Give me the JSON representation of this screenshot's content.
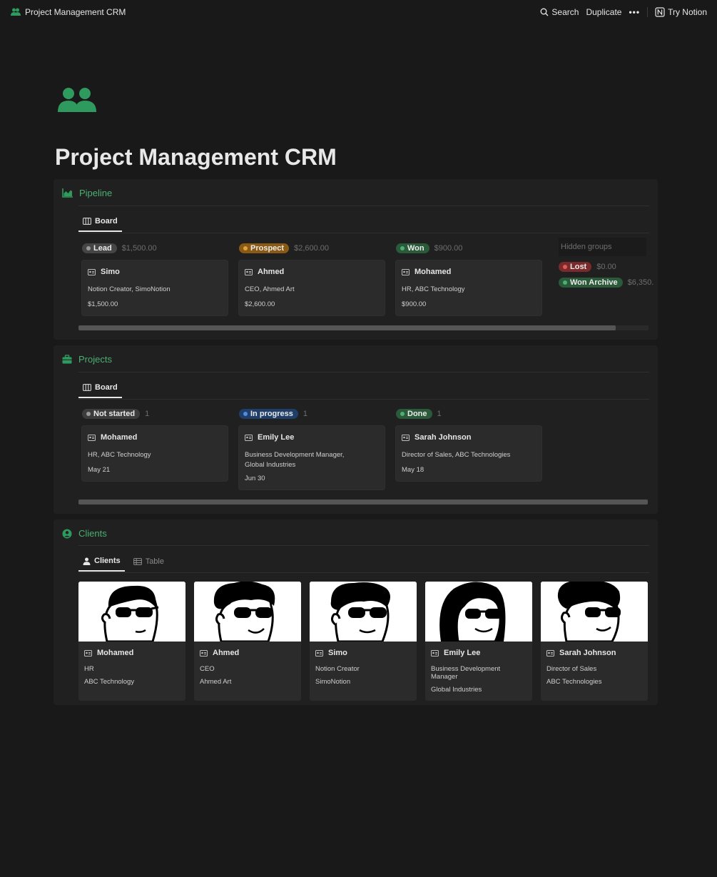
{
  "topbar": {
    "title": "Project Management CRM",
    "search": "Search",
    "duplicate": "Duplicate",
    "more": "•••",
    "try_notion": "Try Notion"
  },
  "page": {
    "title": "Project Management CRM",
    "icon": "people-icon",
    "accent": "#2e9a5e"
  },
  "pipeline": {
    "title": "Pipeline",
    "tab": "Board",
    "columns": [
      {
        "status": "Lead",
        "color": "#5a5a5a",
        "amount": "$1,500.00",
        "card": {
          "name": "Simo",
          "detail": "Notion Creator, SimoNotion",
          "value": "$1,500.00"
        }
      },
      {
        "status": "Prospect",
        "color": "#8a5a14",
        "amount": "$2,600.00",
        "card": {
          "name": "Ahmed",
          "detail": "CEO, Ahmed Art",
          "value": "$2,600.00"
        }
      },
      {
        "status": "Won",
        "color": "#2a5a3a",
        "amount": "$900.00",
        "card": {
          "name": "Mohamed",
          "detail": "HR, ABC Technology",
          "value": "$900.00"
        }
      }
    ],
    "hidden_groups": {
      "label": "Hidden groups",
      "items": [
        {
          "status": "Lost",
          "color": "#7a2a2a",
          "amount": "$0.00"
        },
        {
          "status": "Won Archive",
          "color": "#2a5a3a",
          "amount": "$6,350."
        }
      ]
    }
  },
  "projects": {
    "title": "Projects",
    "tab": "Board",
    "columns": [
      {
        "status": "Not started",
        "color": "#3c3c3c",
        "count": "1",
        "card": {
          "name": "Mohamed",
          "line1": "HR, ABC Technology",
          "line2": "",
          "date": "May 21"
        }
      },
      {
        "status": "In progress",
        "color": "#1f3f6a",
        "count": "1",
        "card": {
          "name": "Emily Lee",
          "line1": "Business Development Manager,",
          "line2": "Global Industries",
          "date": "Jun 30"
        }
      },
      {
        "status": "Done",
        "color": "#2a5a3a",
        "count": "1",
        "card": {
          "name": "Sarah Johnson",
          "line1": "Director of Sales, ABC Technologies",
          "line2": "",
          "date": "May 18"
        }
      }
    ]
  },
  "clients": {
    "title": "Clients",
    "tabs": [
      "Clients",
      "Table"
    ],
    "cards": [
      {
        "name": "Mohamed",
        "role": "HR",
        "company": "ABC Technology"
      },
      {
        "name": "Ahmed",
        "role": "CEO",
        "company": "Ahmed Art"
      },
      {
        "name": "Simo",
        "role": "Notion Creator",
        "company": "SimoNotion"
      },
      {
        "name": "Emily Lee",
        "role": "Business Development Manager",
        "company": "Global Industries"
      },
      {
        "name": "Sarah Johnson",
        "role": "Director of Sales",
        "company": "ABC Technologies"
      }
    ]
  }
}
